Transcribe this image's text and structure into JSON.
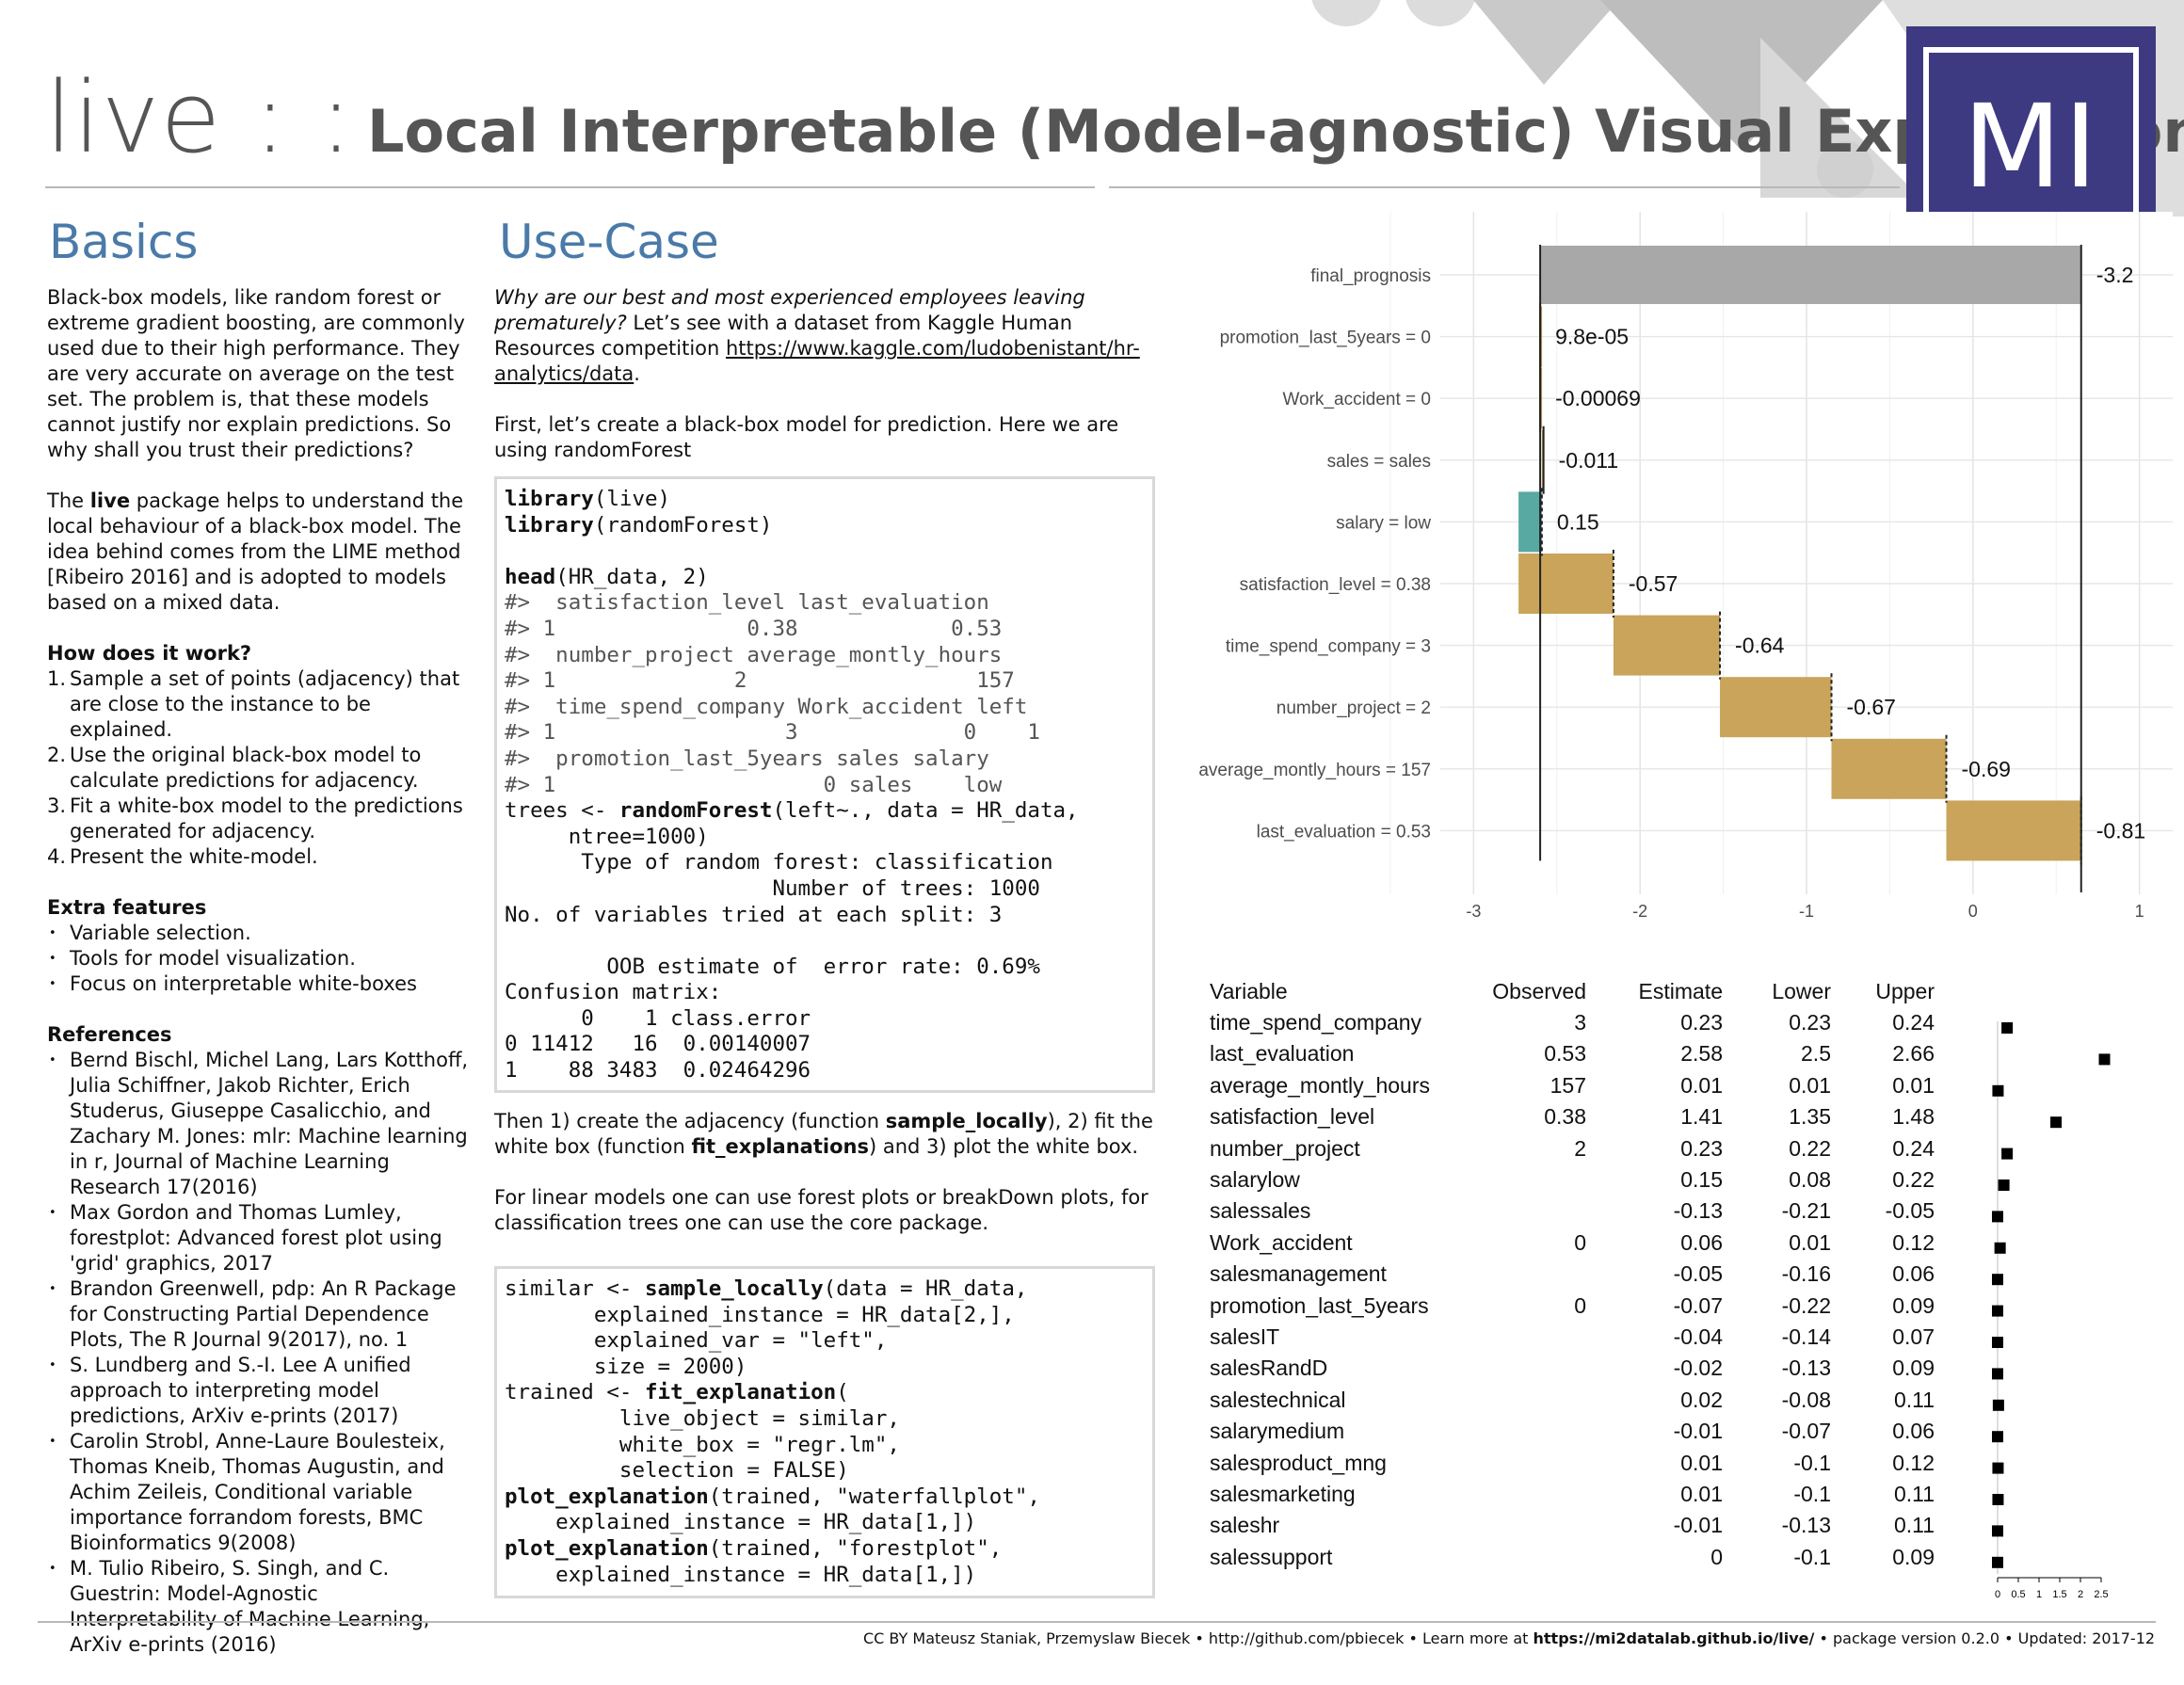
{
  "header": {
    "title_prefix": "live : :",
    "title_main": "Local Interpretable (Model-agnostic) Visual Explanations",
    "logo_text": "MI"
  },
  "basics": {
    "heading": "Basics",
    "para1": "Black-box models, like random forest or extreme gradient boosting, are commonly used due to their high performance. They are very accurate on average on the test set. The problem is, that these models cannot justify nor explain predictions. So why shall you trust their predictions?",
    "para2_pre": "The ",
    "para2_bold": "live",
    "para2_post": " package helps to understand the local behaviour of a black-box model. The idea behind comes from the LIME method [Ribeiro 2016] and is adopted to models based on a mixed data.",
    "how_title": "How does it work?",
    "how_items": [
      {
        "n": "1.",
        "text": "Sample a set of points (adjacency) that are close to the instance to be explained."
      },
      {
        "n": "2.",
        "text": "Use the original black-box model to calculate predictions for adjacency."
      },
      {
        "n": "3.",
        "text": "Fit a white-box model to the predictions generated for adjacency."
      },
      {
        "n": "4.",
        "text": "Present the white-model."
      }
    ],
    "extra_title": "Extra features",
    "extra_items": [
      "Variable selection.",
      "Tools for model visualization.",
      "Focus on interpretable white-boxes"
    ],
    "refs_title": "References",
    "refs": [
      "Bernd Bischl, Michel Lang, Lars Kotthoff, Julia Schiffner, Jakob Richter, Erich Studerus, Giuseppe Casalicchio, and Zachary M. Jones: mlr:  Machine learning in r, Journal of Machine Learning Research 17(2016)",
      "Max Gordon and Thomas Lumley, forestplot: Advanced forest plot using 'grid' graphics, 2017",
      "Brandon Greenwell, pdp:  An R Package for Constructing Partial Dependence Plots, The R Journal 9(2017), no. 1",
      "S. Lundberg and S.-I. Lee  A unified approach to interpreting model predictions, ArXiv e-prints (2017)",
      "Carolin Strobl, Anne-Laure Boulesteix, Thomas Kneib, Thomas Augustin, and Achim Zeileis, Conditional variable importance forrandom forests, BMC Bioinformatics 9(2008)",
      "M. Tulio Ribeiro, S. Singh, and C. Guestrin: Model-Agnostic Interpretability of Machine Learning, ArXiv e-prints (2016)"
    ]
  },
  "usecase": {
    "heading": "Use-Case",
    "intro_italic": "Why are our best and most experienced employees leaving prematurely?",
    "intro_rest": " Let’s see with a dataset from Kaggle Human Resources competition ",
    "intro_link": "https://www.kaggle.com/ludobenistant/hr-analytics/data",
    "intro_end": ".",
    "first": "First, let’s create a black-box model for prediction. Here we are using randomForest",
    "then_1": "Then 1) create the adjacency (function ",
    "then_fn1": "sample_locally",
    "then_2": "), 2) fit the white box (function ",
    "then_fn2": "fit_explanations",
    "then_3": ") and 3) plot the white box.",
    "linear": "For linear models one can use forest plots or breakDown plots, for classification trees one can use the core package."
  },
  "code1": {
    "lines": [
      [
        {
          "b": "library"
        },
        {
          "t": "(live)"
        }
      ],
      [
        {
          "b": "library"
        },
        {
          "t": "(randomForest)"
        }
      ],
      [
        {
          "t": ""
        }
      ],
      [
        {
          "b": "head"
        },
        {
          "t": "(HR_data, 2)"
        }
      ],
      [
        {
          "c": "#>  satisfaction_level last_evaluation"
        }
      ],
      [
        {
          "c": "#> 1               0.38            0.53"
        }
      ],
      [
        {
          "c": "#>  number_project average_montly_hours"
        }
      ],
      [
        {
          "c": "#> 1              2                  157"
        }
      ],
      [
        {
          "c": "#>  time_spend_company Work_accident left"
        }
      ],
      [
        {
          "c": "#> 1                  3             0    1"
        }
      ],
      [
        {
          "c": "#>  promotion_last_5years sales salary"
        }
      ],
      [
        {
          "c": "#> 1                     0 sales    low"
        }
      ],
      [
        {
          "t": "trees <- "
        },
        {
          "b": "randomForest"
        },
        {
          "t": "(left~., data = HR_data,"
        }
      ],
      [
        {
          "t": "     ntree=1000)"
        }
      ],
      [
        {
          "t": "      Type of random forest: classification"
        }
      ],
      [
        {
          "t": "                     Number of trees: 1000"
        }
      ],
      [
        {
          "t": "No. of variables tried at each split: 3"
        }
      ],
      [
        {
          "t": ""
        }
      ],
      [
        {
          "t": "        OOB estimate of  error rate: 0.69%"
        }
      ],
      [
        {
          "t": "Confusion matrix:"
        }
      ],
      [
        {
          "t": "      0    1 class.error"
        }
      ],
      [
        {
          "t": "0 11412   16  0.00140007"
        }
      ],
      [
        {
          "t": "1    88 3483  0.02464296"
        }
      ]
    ]
  },
  "code2": {
    "lines": [
      [
        {
          "t": "similar <- "
        },
        {
          "b": "sample_locally"
        },
        {
          "t": "(data = HR_data,"
        }
      ],
      [
        {
          "t": "       explained_instance = HR_data[2,],"
        }
      ],
      [
        {
          "t": "       explained_var = \"left\","
        }
      ],
      [
        {
          "t": "       size = 2000)"
        }
      ],
      [
        {
          "t": "trained <- "
        },
        {
          "b": "fit_explanation"
        },
        {
          "t": "("
        }
      ],
      [
        {
          "t": "         live_object = similar,"
        }
      ],
      [
        {
          "t": "         white_box = \"regr.lm\","
        }
      ],
      [
        {
          "t": "         selection = FALSE)"
        }
      ],
      [
        {
          "b": "plot_explanation"
        },
        {
          "t": "(trained, \"waterfallplot\","
        }
      ],
      [
        {
          "t": "    explained_instance = HR_data[1,])"
        }
      ],
      [
        {
          "b": "plot_explanation"
        },
        {
          "t": "(trained, \"forestplot\","
        }
      ],
      [
        {
          "t": "    explained_instance = HR_data[1,])"
        }
      ]
    ]
  },
  "chart_data": [
    {
      "type": "bar",
      "subtype": "waterfall",
      "title": "",
      "xlabel": "",
      "ylabel": "",
      "xlim": [
        -3.2,
        1.2
      ],
      "xticks": [
        -3,
        -2,
        -1,
        0,
        1
      ],
      "grid": true,
      "intercept": -2.6,
      "final_value": 0.65,
      "categories": [
        "final_prognosis",
        "promotion_last_5years = 0",
        "Work_accident = 0",
        "sales = sales",
        "salary = low",
        "satisfaction_level = 0.38",
        "time_spend_company = 3",
        "number_project = 2",
        "average_montly_hours = 157",
        "last_evaluation = 0.53"
      ],
      "labels": [
        "-3.2",
        "9.8e-05",
        "-0.00069",
        "-0.011",
        "0.15",
        "-0.57",
        "-0.64",
        "-0.67",
        "-0.69",
        "-0.81"
      ],
      "values": [
        -3.2,
        9.8e-05,
        -0.00069,
        -0.011,
        0.15,
        -0.57,
        -0.64,
        -0.67,
        -0.69,
        -0.81
      ],
      "bars": [
        {
          "from": -2.6,
          "to": 0.65,
          "color": "#a8a8a8"
        },
        {
          "from": -2.6,
          "to": -2.6,
          "color": "#c9a45a"
        },
        {
          "from": -2.6,
          "to": -2.6,
          "color": "#c9a45a"
        },
        {
          "from": -2.59,
          "to": -2.58,
          "color": "#c9a45a"
        },
        {
          "from": -2.73,
          "to": -2.59,
          "color": "#57a9a2"
        },
        {
          "from": -2.73,
          "to": -2.16,
          "color": "#c9a45a"
        },
        {
          "from": -2.16,
          "to": -1.52,
          "color": "#c9a45a"
        },
        {
          "from": -1.52,
          "to": -0.85,
          "color": "#c9a45a"
        },
        {
          "from": -0.85,
          "to": -0.16,
          "color": "#c9a45a"
        },
        {
          "from": -0.16,
          "to": 0.65,
          "color": "#c9a45a"
        }
      ]
    },
    {
      "type": "table",
      "subtype": "forestplot",
      "columns": [
        "Variable",
        "Observed",
        "Estimate",
        "Lower",
        "Upper"
      ],
      "rows": [
        [
          "time_spend_company",
          "3",
          "0.23",
          "0.23",
          "0.24"
        ],
        [
          "last_evaluation",
          "0.53",
          "2.58",
          "2.5",
          "2.66"
        ],
        [
          "average_montly_hours",
          "157",
          "0.01",
          "0.01",
          "0.01"
        ],
        [
          "satisfaction_level",
          "0.38",
          "1.41",
          "1.35",
          "1.48"
        ],
        [
          "number_project",
          "2",
          "0.23",
          "0.22",
          "0.24"
        ],
        [
          "salarylow",
          "",
          "0.15",
          "0.08",
          "0.22"
        ],
        [
          "salessales",
          "",
          "-0.13",
          "-0.21",
          "-0.05"
        ],
        [
          "Work_accident",
          "0",
          "0.06",
          "0.01",
          "0.12"
        ],
        [
          "salesmanagement",
          "",
          "-0.05",
          "-0.16",
          "0.06"
        ],
        [
          "promotion_last_5years",
          "0",
          "-0.07",
          "-0.22",
          "0.09"
        ],
        [
          "salesIT",
          "",
          "-0.04",
          "-0.14",
          "0.07"
        ],
        [
          "salesRandD",
          "",
          "-0.02",
          "-0.13",
          "0.09"
        ],
        [
          "salestechnical",
          "",
          "0.02",
          "-0.08",
          "0.11"
        ],
        [
          "salarymedium",
          "",
          "-0.01",
          "-0.07",
          "0.06"
        ],
        [
          "salesproduct_mng",
          "",
          "0.01",
          "-0.1",
          "0.12"
        ],
        [
          "salesmarketing",
          "",
          "0.01",
          "-0.1",
          "0.11"
        ],
        [
          "saleshr",
          "",
          "-0.01",
          "-0.13",
          "0.11"
        ],
        [
          "salessupport",
          "",
          "0",
          "-0.1",
          "0.09"
        ]
      ],
      "axis_ticks": [
        "0",
        "0.5",
        "1",
        "1.5",
        "2",
        "2.5"
      ],
      "xlim": [
        0,
        2.5
      ]
    }
  ],
  "footer": {
    "pre": "CC BY Mateusz Staniak, Przemyslaw Biecek  •  http://github.com/pbiecek •  Learn more at  ",
    "url": "https://mi2datalab.github.io/live/",
    "post": "  •  package version  0.2.0 •  Updated: 2017-12"
  },
  "colors": {
    "heading_blue": "#4a7aa8",
    "logo_purple": "#3d3a82",
    "negative_bar": "#c9a45a",
    "positive_bar": "#57a9a2",
    "final_bar": "#a8a8a8"
  }
}
